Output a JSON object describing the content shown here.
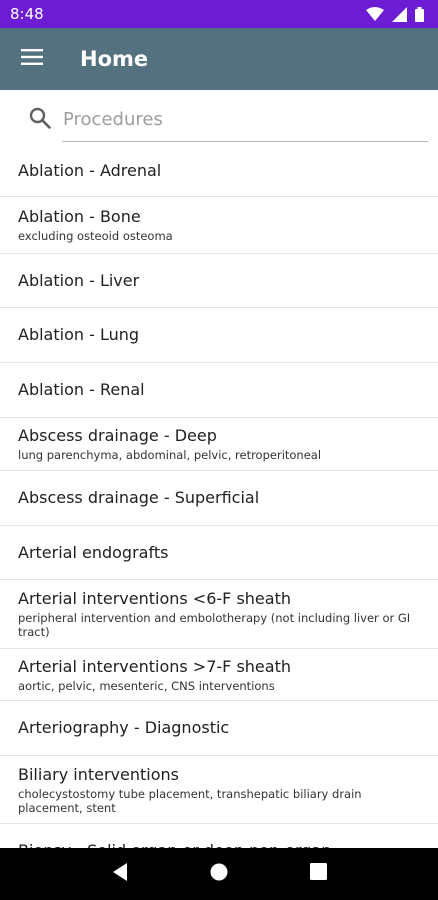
{
  "status_bar": {
    "time": "8:48",
    "icons": [
      "wifi-icon",
      "signal-icon",
      "battery-icon"
    ]
  },
  "app_bar": {
    "title": "Home",
    "menu_icon": "menu-icon"
  },
  "search": {
    "placeholder": "Procedures",
    "value": ""
  },
  "procedures": [
    {
      "title": "Ablation - Adrenal",
      "subtitle": ""
    },
    {
      "title": "Ablation - Bone",
      "subtitle": "excluding osteoid osteoma"
    },
    {
      "title": "Ablation - Liver",
      "subtitle": ""
    },
    {
      "title": "Ablation - Lung",
      "subtitle": ""
    },
    {
      "title": "Ablation - Renal",
      "subtitle": ""
    },
    {
      "title": "Abscess drainage - Deep",
      "subtitle": "lung parenchyma, abdominal, pelvic, retroperitoneal"
    },
    {
      "title": "Abscess drainage - Superficial",
      "subtitle": ""
    },
    {
      "title": "Arterial endografts",
      "subtitle": ""
    },
    {
      "title": "Arterial interventions <6-F sheath",
      "subtitle": "peripheral intervention and embolotherapy (not including liver or GI tract)"
    },
    {
      "title": "Arterial interventions >7-F sheath",
      "subtitle": "aortic, pelvic, mesenteric, CNS interventions"
    },
    {
      "title": "Arteriography - Diagnostic",
      "subtitle": ""
    },
    {
      "title": "Biliary interventions",
      "subtitle": "cholecystostomy tube placement, transhepatic biliary drain placement, stent"
    },
    {
      "title": "Biopsy - Solid organ or deep non-organ",
      "subtitle": ""
    }
  ],
  "nav_bar": {
    "buttons": [
      "back-icon",
      "home-icon",
      "recents-icon"
    ]
  },
  "colors": {
    "status_bar": "#6c1dd4",
    "app_bar": "#53717f"
  }
}
